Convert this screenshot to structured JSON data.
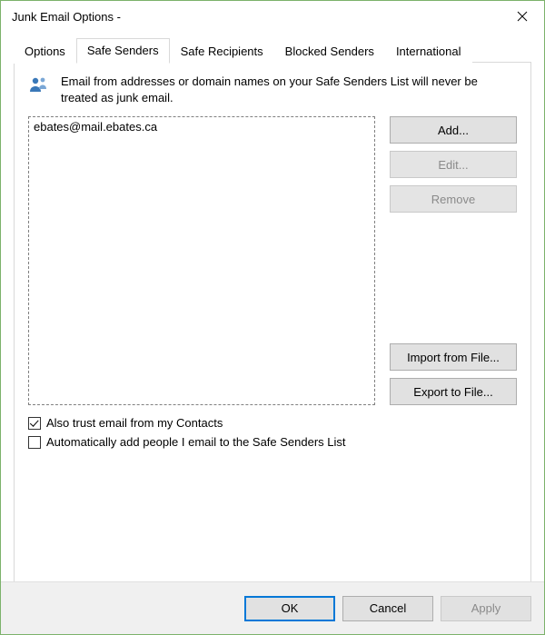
{
  "window": {
    "title": "Junk Email Options - "
  },
  "tabs": {
    "options": "Options",
    "safe_senders": "Safe Senders",
    "safe_recipients": "Safe Recipients",
    "blocked_senders": "Blocked Senders",
    "international": "International",
    "active": "safe_senders"
  },
  "body": {
    "description": "Email from addresses or domain names on your Safe Senders List will never be treated as junk email."
  },
  "list": {
    "items": [
      "ebates@mail.ebates.ca"
    ]
  },
  "buttons": {
    "add": "Add...",
    "edit": "Edit...",
    "remove": "Remove",
    "import": "Import from File...",
    "export": "Export to File..."
  },
  "checks": {
    "trust_contacts": {
      "label": "Also trust email from my Contacts",
      "checked": true
    },
    "auto_add": {
      "label": "Automatically add people I email to the Safe Senders List",
      "checked": false
    }
  },
  "footer": {
    "ok": "OK",
    "cancel": "Cancel",
    "apply": "Apply"
  }
}
